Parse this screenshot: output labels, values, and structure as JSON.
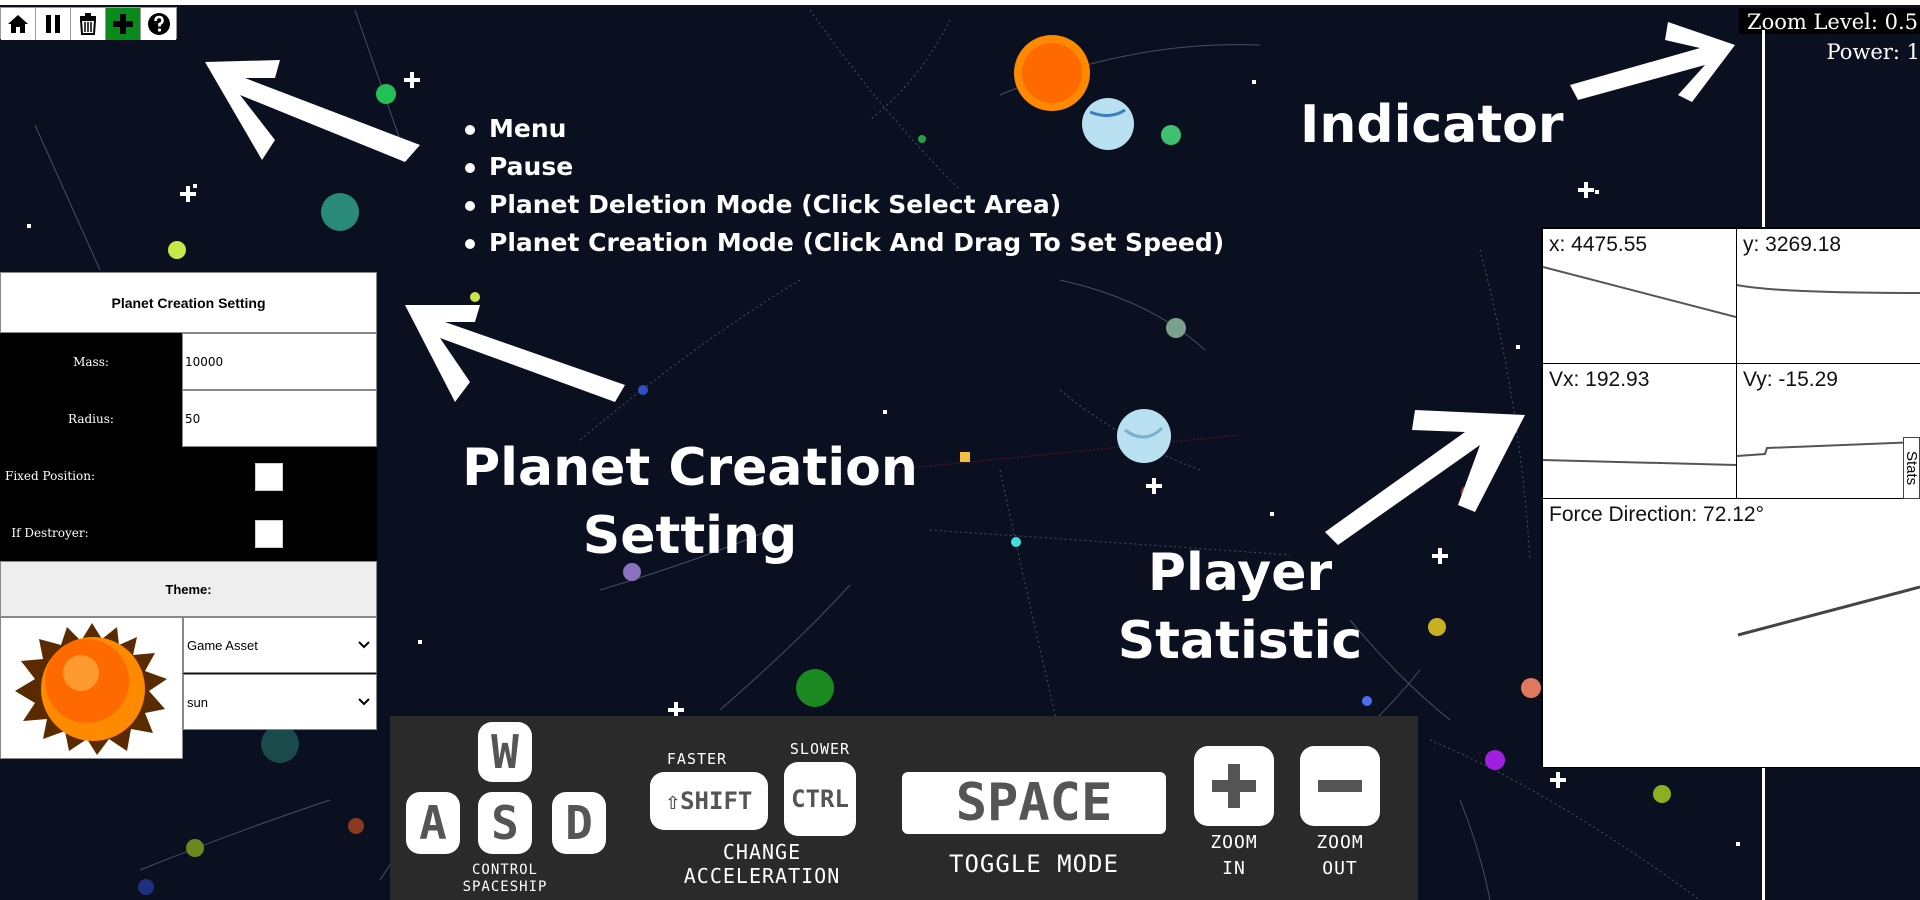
{
  "toolbar": {
    "buttons": [
      {
        "name": "home-button",
        "icon": "home-icon"
      },
      {
        "name": "pause-button",
        "icon": "pause-icon"
      },
      {
        "name": "delete-button",
        "icon": "trash-icon"
      },
      {
        "name": "add-button",
        "icon": "plus-icon"
      },
      {
        "name": "help-button",
        "icon": "question-icon"
      }
    ]
  },
  "annotations": {
    "bullets": [
      "Menu",
      "Pause",
      "Planet Deletion Mode (Click Select Area)",
      "Planet Creation Mode (Click And Drag To Set Speed)"
    ],
    "indicator": "Indicator",
    "planet_creation_line1": "Planet Creation",
    "planet_creation_line2": "Setting",
    "player_stat_line1": "Player",
    "player_stat_line2": "Statistic"
  },
  "indicator": {
    "zoom": "Zoom Level: 0.5",
    "power": "Power: 1"
  },
  "planet_creation": {
    "title": "Planet Creation Setting",
    "mass_label": "Mass:",
    "mass_value": "10000",
    "radius_label": "Radius:",
    "radius_value": "50",
    "fixed_label": "Fixed Position:",
    "destroyer_label": "If Destroyer:",
    "theme_label": "Theme:",
    "theme_category": "Game Asset",
    "theme_asset": "sun"
  },
  "stats": {
    "x": "x: 4475.55",
    "y": "y: 3269.18",
    "vx": "Vx: 192.93",
    "vy": "Vy: -15.29",
    "force": "Force Direction: 72.12°",
    "tab": "Stats"
  },
  "controls": {
    "w": "W",
    "a": "A",
    "s": "S",
    "d": "D",
    "wasd_caption_1": "CONTROL",
    "wasd_caption_2": "SPACESHIP",
    "faster": "FASTER",
    "slower": "SLOWER",
    "shift": "⇧SHIFT",
    "ctrl": "CTRL",
    "accel_1": "CHANGE",
    "accel_2": "ACCELERATION",
    "space": "SPACE",
    "toggle": "TOGGLE MODE",
    "zoom_in_1": "ZOOM",
    "zoom_in_2": "IN",
    "zoom_out_1": "ZOOM",
    "zoom_out_2": "OUT"
  },
  "colors": {
    "background": "#0b1020",
    "active_tool": "#0a8a1a",
    "sun": "#ff7a00"
  }
}
